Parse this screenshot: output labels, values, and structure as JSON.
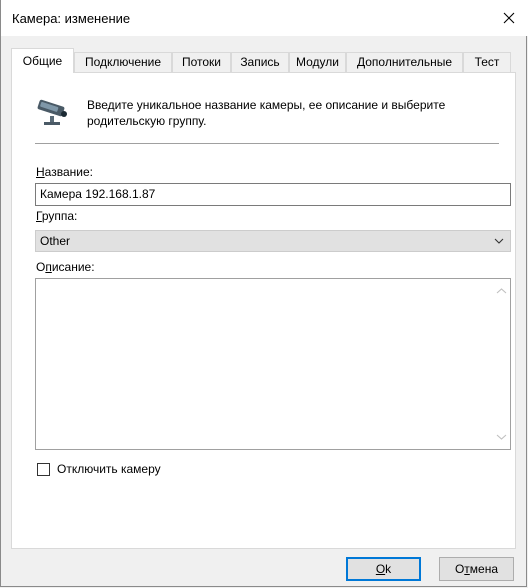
{
  "window": {
    "title": "Камера: изменение"
  },
  "tabs": [
    {
      "label": "Общие",
      "active": true
    },
    {
      "label": "Подключение",
      "active": false
    },
    {
      "label": "Потоки",
      "active": false
    },
    {
      "label": "Запись",
      "active": false
    },
    {
      "label": "Модули",
      "active": false
    },
    {
      "label": "Дополнительные",
      "active": false
    },
    {
      "label": "Тест",
      "active": false
    }
  ],
  "general": {
    "info_icon": "security-camera-icon",
    "info_text": "Введите уникальное название камеры, ее описание и выберите родительскую группу.",
    "name_label": "Название:",
    "name_value": "Камера 192.168.1.87",
    "group_label": "Группа:",
    "group_value": "Other",
    "description_label": "Описание:",
    "description_value": "",
    "disable_label": "Отключить камеру",
    "disable_checked": false
  },
  "buttons": {
    "ok": "Ok",
    "cancel": "Отмена"
  },
  "colors": {
    "accent": "#0078d7"
  }
}
